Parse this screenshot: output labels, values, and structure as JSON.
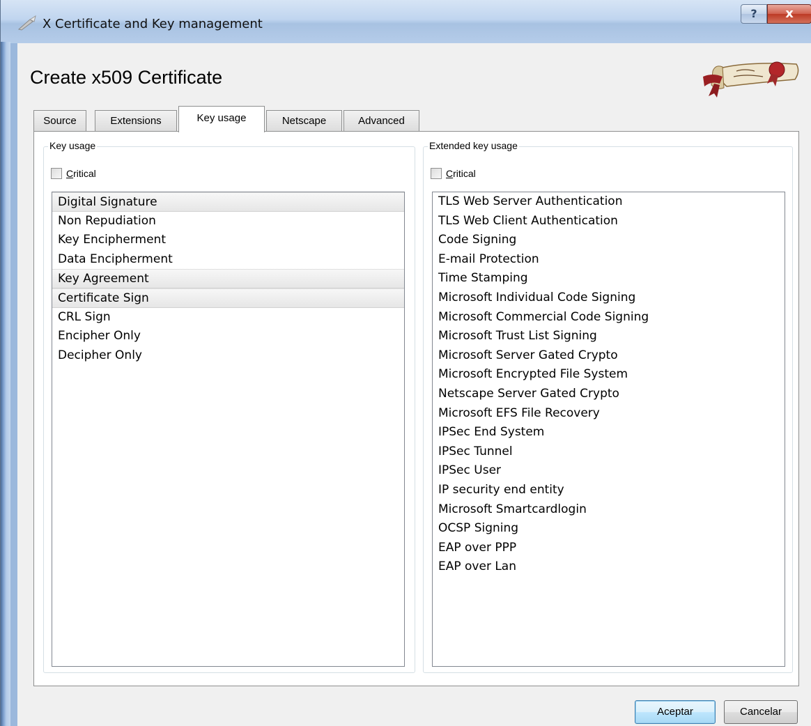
{
  "window": {
    "title": "X Certificate and Key management",
    "help_label": "?",
    "close_label": "x"
  },
  "dialog": {
    "heading": "Create x509 Certificate",
    "logo_text": "Certificate"
  },
  "tabs": [
    {
      "label": "Source",
      "active": false
    },
    {
      "label": "Extensions",
      "active": false
    },
    {
      "label": "Key usage",
      "active": true
    },
    {
      "label": "Netscape",
      "active": false
    },
    {
      "label": "Advanced",
      "active": false
    }
  ],
  "key_usage": {
    "group_title": "Key usage",
    "critical_label": "Critical",
    "critical_checked": false,
    "items": [
      {
        "label": "Digital Signature",
        "selected": true
      },
      {
        "label": "Non Repudiation",
        "selected": false
      },
      {
        "label": "Key Encipherment",
        "selected": false
      },
      {
        "label": "Data Encipherment",
        "selected": false
      },
      {
        "label": "Key Agreement",
        "selected": true
      },
      {
        "label": "Certificate Sign",
        "selected": true
      },
      {
        "label": "CRL Sign",
        "selected": false
      },
      {
        "label": "Encipher Only",
        "selected": false
      },
      {
        "label": "Decipher Only",
        "selected": false
      }
    ]
  },
  "extended_key_usage": {
    "group_title": "Extended key usage",
    "critical_label": "Critical",
    "critical_checked": false,
    "items": [
      {
        "label": "TLS Web Server Authentication",
        "selected": false
      },
      {
        "label": "TLS Web Client Authentication",
        "selected": false
      },
      {
        "label": "Code Signing",
        "selected": false
      },
      {
        "label": "E-mail Protection",
        "selected": false
      },
      {
        "label": "Time Stamping",
        "selected": false
      },
      {
        "label": "Microsoft Individual Code Signing",
        "selected": false
      },
      {
        "label": "Microsoft Commercial Code Signing",
        "selected": false
      },
      {
        "label": "Microsoft Trust List Signing",
        "selected": false
      },
      {
        "label": "Microsoft Server Gated Crypto",
        "selected": false
      },
      {
        "label": "Microsoft Encrypted File System",
        "selected": false
      },
      {
        "label": "Netscape Server Gated Crypto",
        "selected": false
      },
      {
        "label": "Microsoft EFS File Recovery",
        "selected": false
      },
      {
        "label": "IPSec End System",
        "selected": false
      },
      {
        "label": "IPSec Tunnel",
        "selected": false
      },
      {
        "label": "IPSec User",
        "selected": false
      },
      {
        "label": "IP security end entity",
        "selected": false
      },
      {
        "label": "Microsoft Smartcardlogin",
        "selected": false
      },
      {
        "label": "OCSP Signing",
        "selected": false
      },
      {
        "label": "EAP over PPP",
        "selected": false
      },
      {
        "label": "EAP over Lan",
        "selected": false
      }
    ]
  },
  "buttons": {
    "ok_label": "Aceptar",
    "cancel_label": "Cancelar"
  },
  "colors": {
    "accent": "#3c7fb1",
    "close_red": "#c7442f",
    "seal_red": "#a0282a"
  }
}
